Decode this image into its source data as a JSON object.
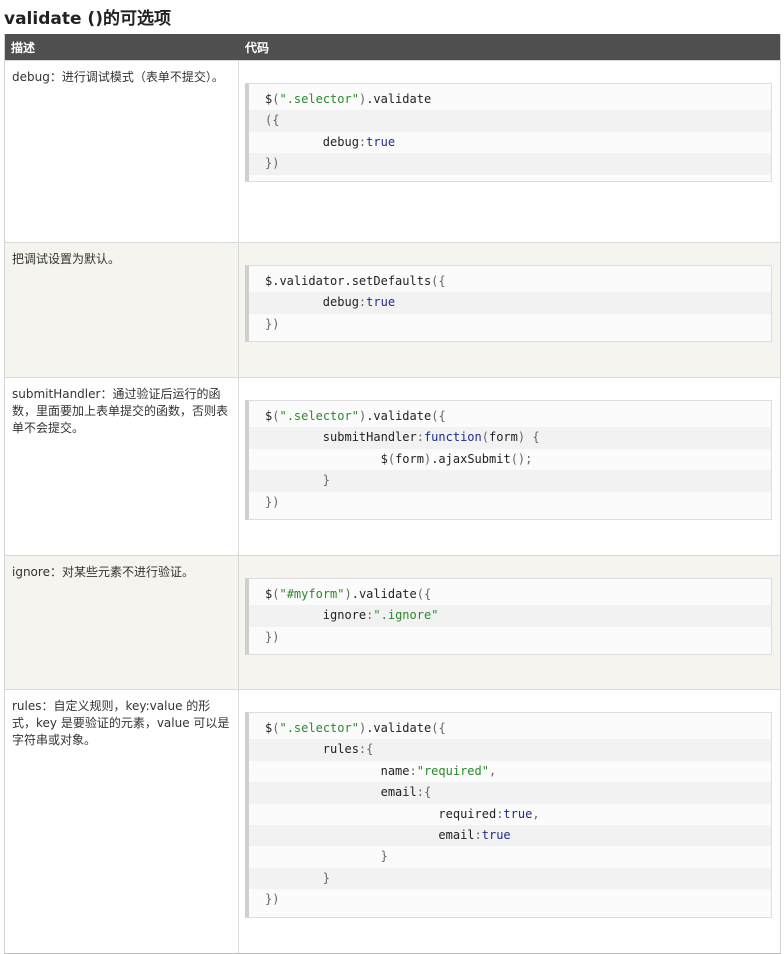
{
  "page": {
    "title": "validate ()的可选项"
  },
  "table": {
    "headers": {
      "description": "描述",
      "code": "代码"
    },
    "rows": [
      {
        "description": "debug：进行调试模式（表单不提交）。",
        "code": [
          [
            [
              "$",
              "id"
            ],
            [
              "(",
              "pun"
            ],
            [
              "\".selector\"",
              "str"
            ],
            [
              ")",
              "pun"
            ],
            [
              ".validate",
              "id"
            ]
          ],
          [
            [
              "({",
              "pun"
            ]
          ],
          [
            [
              "        debug",
              "id"
            ],
            [
              ":",
              "pun"
            ],
            [
              "true",
              "kw"
            ]
          ],
          [
            [
              "})",
              "pun"
            ]
          ]
        ]
      },
      {
        "description": "把调试设置为默认。",
        "code": [
          [
            [
              "$.validator.setDefaults",
              "id"
            ],
            [
              "({",
              "pun"
            ]
          ],
          [
            [
              "        debug",
              "id"
            ],
            [
              ":",
              "pun"
            ],
            [
              "true",
              "kw"
            ]
          ],
          [
            [
              "})",
              "pun"
            ]
          ]
        ]
      },
      {
        "description": "submitHandler：通过验证后运行的函数，里面要加上表单提交的函数，否则表单不会提交。",
        "code": [
          [
            [
              "$",
              "id"
            ],
            [
              "(",
              "pun"
            ],
            [
              "\".selector\"",
              "str"
            ],
            [
              ")",
              "pun"
            ],
            [
              ".validate",
              "id"
            ],
            [
              "({",
              "pun"
            ]
          ],
          [
            [
              "        submitHandler",
              "id"
            ],
            [
              ":",
              "pun"
            ],
            [
              "function",
              "kw"
            ],
            [
              "(",
              "pun"
            ],
            [
              "form",
              "id"
            ],
            [
              ")",
              "pun"
            ],
            [
              " {",
              "pun"
            ]
          ],
          [
            [
              "                $",
              "id"
            ],
            [
              "(",
              "pun"
            ],
            [
              "form",
              "id"
            ],
            [
              ")",
              "pun"
            ],
            [
              ".ajaxSubmit",
              "id"
            ],
            [
              "();",
              "pun"
            ]
          ],
          [
            [
              "        }",
              "pun"
            ]
          ],
          [
            [
              "})",
              "pun"
            ]
          ]
        ]
      },
      {
        "description": "ignore：对某些元素不进行验证。",
        "code": [
          [
            [
              "$",
              "id"
            ],
            [
              "(",
              "pun"
            ],
            [
              "\"#myform\"",
              "str"
            ],
            [
              ")",
              "pun"
            ],
            [
              ".validate",
              "id"
            ],
            [
              "({",
              "pun"
            ]
          ],
          [
            [
              "        ignore",
              "id"
            ],
            [
              ":",
              "pun"
            ],
            [
              "\".ignore\"",
              "str"
            ]
          ],
          [
            [
              "})",
              "pun"
            ]
          ]
        ]
      },
      {
        "description": "rules：自定义规则，key:value 的形式，key 是要验证的元素，value 可以是字符串或对象。",
        "code": [
          [
            [
              "$",
              "id"
            ],
            [
              "(",
              "pun"
            ],
            [
              "\".selector\"",
              "str"
            ],
            [
              ")",
              "pun"
            ],
            [
              ".validate",
              "id"
            ],
            [
              "({",
              "pun"
            ]
          ],
          [
            [
              "        rules",
              "id"
            ],
            [
              ":{",
              "pun"
            ]
          ],
          [
            [
              "                name",
              "id"
            ],
            [
              ":",
              "pun"
            ],
            [
              "\"required\"",
              "str"
            ],
            [
              ",",
              "pun"
            ]
          ],
          [
            [
              "                email",
              "id"
            ],
            [
              ":{",
              "pun"
            ]
          ],
          [
            [
              "                        required",
              "id"
            ],
            [
              ":",
              "pun"
            ],
            [
              "true",
              "kw"
            ],
            [
              ",",
              "pun"
            ]
          ],
          [
            [
              "                        email",
              "id"
            ],
            [
              ":",
              "pun"
            ],
            [
              "true",
              "kw"
            ]
          ],
          [
            [
              "                }",
              "pun"
            ]
          ],
          [
            [
              "        }",
              "pun"
            ]
          ],
          [
            [
              "})",
              "pun"
            ]
          ]
        ]
      }
    ]
  }
}
